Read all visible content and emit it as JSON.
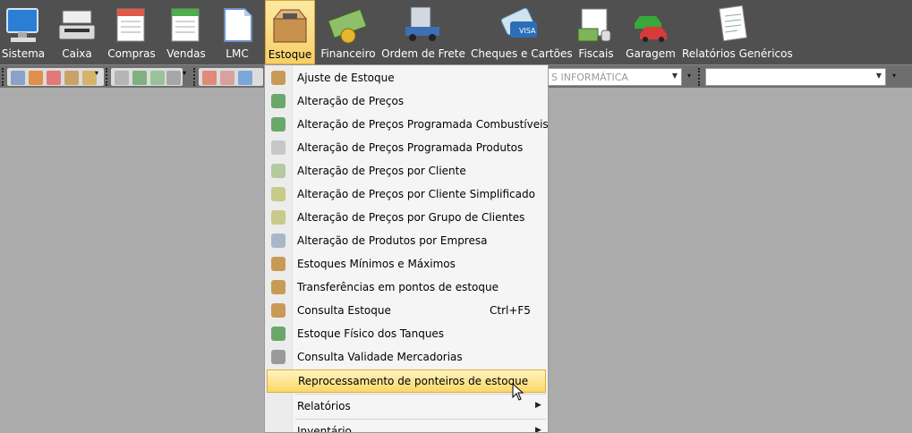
{
  "ribbon": {
    "items": [
      {
        "label": "Sistema",
        "icon": "computer-icon"
      },
      {
        "label": "Caixa",
        "icon": "cash-register-icon"
      },
      {
        "label": "Compras",
        "icon": "purchases-form-icon"
      },
      {
        "label": "Vendas",
        "icon": "sales-form-icon"
      },
      {
        "label": "LMC",
        "icon": "document-icon"
      },
      {
        "label": "Estoque",
        "icon": "stock-box-icon"
      },
      {
        "label": "Financeiro",
        "icon": "money-icon"
      },
      {
        "label": "Ordem de Frete",
        "icon": "truck-icon"
      },
      {
        "label": "Cheques e Cartões",
        "icon": "cards-icon"
      },
      {
        "label": "Fiscais",
        "icon": "fiscal-icon"
      },
      {
        "label": "Garagem",
        "icon": "cars-icon"
      },
      {
        "label": "Relatórios Genéricos",
        "icon": "report-icon"
      }
    ],
    "active_color": "#f8cf66",
    "background": "#505050"
  },
  "toolstrip": {
    "company_combo": "S INFORMÁTICA",
    "second_combo": ""
  },
  "menu": {
    "items": [
      {
        "label": "Ajuste de Estoque",
        "icon": "boxes-icon"
      },
      {
        "label": "Alteração de Preços",
        "icon": "price-tag-icon"
      },
      {
        "label": "Alteração de Preços Programada Combustíveis",
        "icon": "price-tag-icon"
      },
      {
        "label": "Alteração de Preços Programada Produtos",
        "icon": "schedule-icon"
      },
      {
        "label": "Alteração de Preços por Cliente",
        "icon": "client-price-icon"
      },
      {
        "label": "Alteração de Preços por Cliente Simplificado",
        "icon": "client-price-icon"
      },
      {
        "label": "Alteração de Preços por Grupo de Clientes",
        "icon": "client-group-icon"
      },
      {
        "label": "Alteração de Produtos por Empresa",
        "icon": "products-company-icon"
      },
      {
        "label": "Estoques Mínimos e Máximos",
        "icon": "boxes-icon"
      },
      {
        "label": "Transferências em pontos de estoque",
        "icon": "transfer-icon"
      },
      {
        "label": "Consulta Estoque",
        "icon": "search-boxes-icon",
        "shortcut": "Ctrl+F5"
      },
      {
        "label": "Estoque Físico dos Tanques",
        "icon": "tank-icon"
      },
      {
        "label": "Consulta Validade Mercadorias",
        "icon": "safe-icon"
      },
      {
        "label": "Reprocessamento de ponteiros de estoque",
        "icon": "",
        "highlighted": true
      },
      {
        "label": "Relatórios",
        "icon": "",
        "submenu": true
      },
      {
        "label": "Inventário",
        "icon": "",
        "submenu": true
      }
    ],
    "highlight_color": "#fbd867"
  }
}
